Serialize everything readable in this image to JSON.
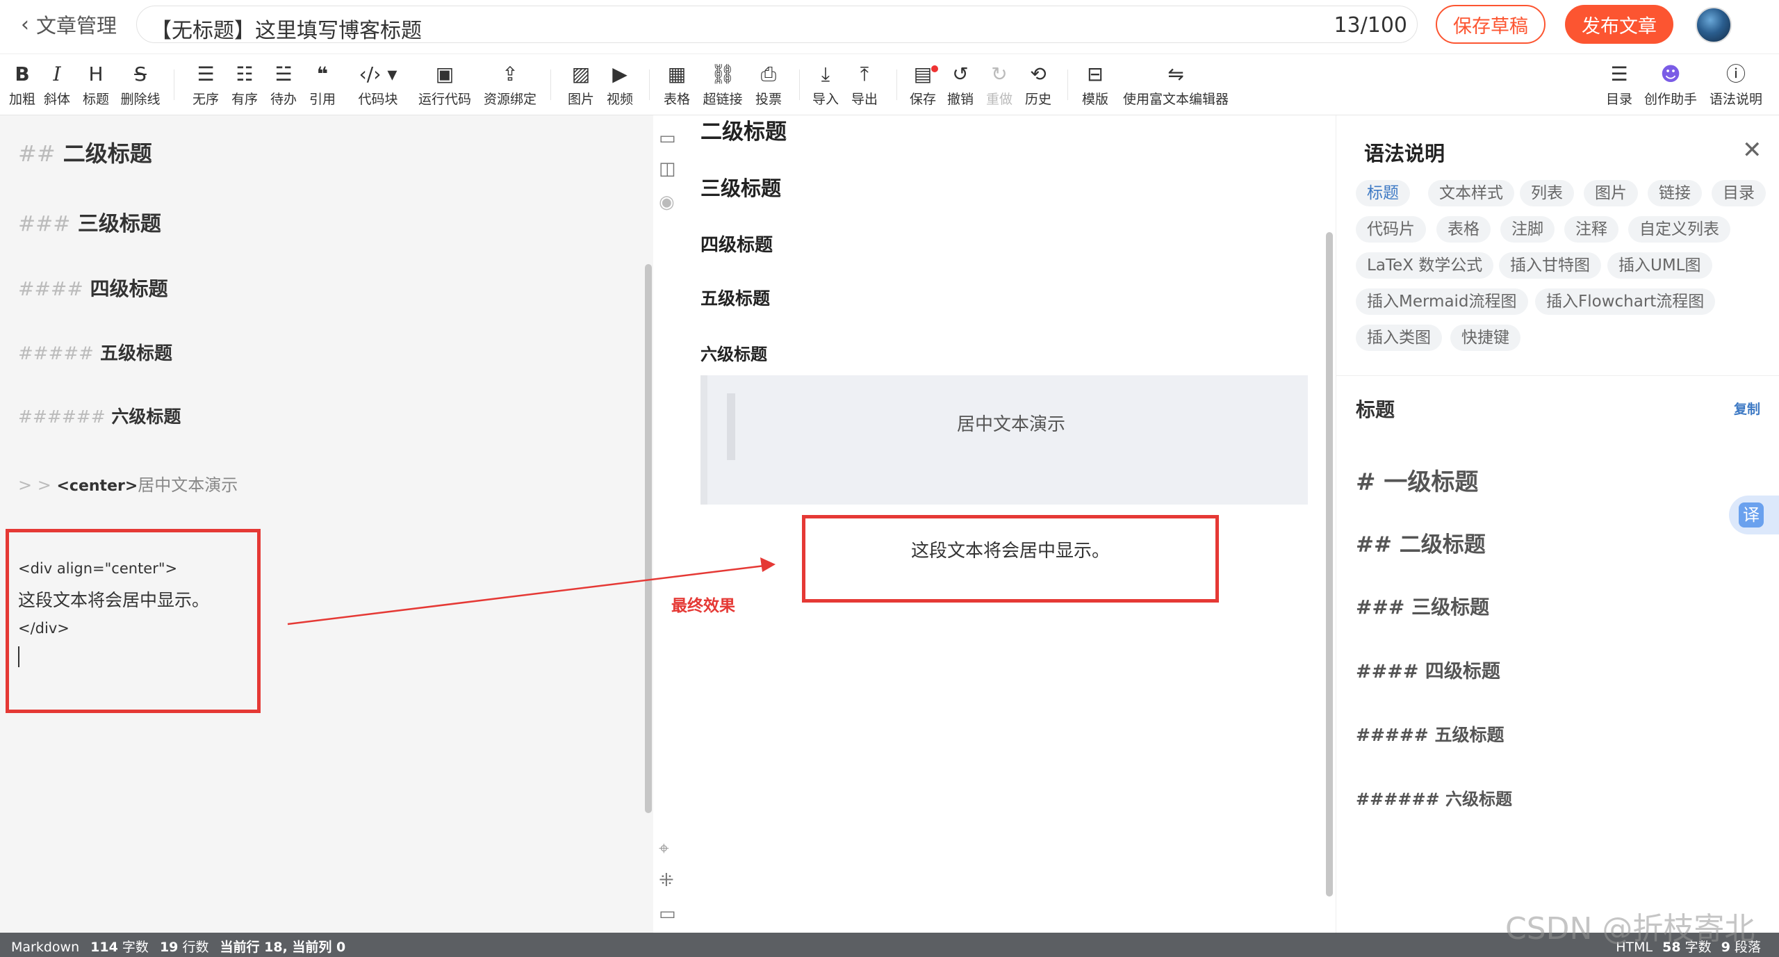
{
  "header": {
    "back_label": "文章管理",
    "title": "【无标题】这里填写博客标题",
    "char_count": "13/100",
    "save_draft": "保存草稿",
    "publish": "发布文章"
  },
  "toolbar": {
    "bold": "加粗",
    "italic": "斜体",
    "heading": "标题",
    "strike": "删除线",
    "unordered": "无序",
    "ordered": "有序",
    "todo": "待办",
    "quote": "引用",
    "codeblock": "代码块",
    "run_code": "运行代码",
    "resource_bind": "资源绑定",
    "image": "图片",
    "video": "视频",
    "table": "表格",
    "link": "超链接",
    "vote": "投票",
    "import": "导入",
    "export": "导出",
    "save": "保存",
    "undo": "撤销",
    "redo": "重做",
    "history": "历史",
    "template": "模版",
    "rich_editor": "使用富文本编辑器",
    "toc": "目录",
    "assistant": "创作助手",
    "syntax_help": "语法说明"
  },
  "editor": {
    "h2": {
      "hash": "##",
      "text": "二级标题"
    },
    "h3": {
      "hash": "###",
      "text": "三级标题"
    },
    "h4": {
      "hash": "####",
      "text": "四级标题"
    },
    "h5": {
      "hash": "#####",
      "text": "五级标题"
    },
    "h6": {
      "hash": "######",
      "text": "六级标题"
    },
    "quote": {
      "prefix": "> >",
      "tag": "<center>",
      "text": "居中文本演示"
    },
    "div_open": "<div align=\"center\">",
    "div_text": "这段文本将会居中显示。",
    "div_close": "</div>"
  },
  "preview": {
    "h2": "二级标题",
    "h3": "三级标题",
    "h4": "四级标题",
    "h5": "五级标题",
    "h6": "六级标题",
    "quote_text": "居中文本演示",
    "centered_text": "这段文本将会居中显示。",
    "final_label": "最终效果"
  },
  "panel": {
    "title": "语法说明",
    "chips": [
      "标题",
      "文本样式",
      "列表",
      "图片",
      "链接",
      "目录",
      "代码片",
      "表格",
      "注脚",
      "注释",
      "自定义列表",
      "LaTeX 数学公式",
      "插入甘特图",
      "插入UML图",
      "插入Mermaid流程图",
      "插入Flowchart流程图",
      "插入类图",
      "快捷键"
    ],
    "section_title": "标题",
    "copy": "复制",
    "examples": [
      "# 一级标题",
      "## 二级标题",
      "### 三级标题",
      "#### 四级标题",
      "##### 五级标题",
      "###### 六级标题"
    ],
    "translate": "译"
  },
  "status": {
    "mode": "Markdown",
    "chars": "114",
    "chars_label": "字数",
    "lines": "19",
    "lines_label": "行数",
    "position": "当前行 18, 当前列 0",
    "right_mode": "HTML",
    "right_chars": "58",
    "right_chars_label": "字数",
    "right_paras": "9",
    "right_paras_label": "段落"
  },
  "watermark": "CSDN @折枝寄北",
  "colors": {
    "accent": "#fc5531",
    "annotation": "#e53935",
    "link": "#3d79c4"
  }
}
